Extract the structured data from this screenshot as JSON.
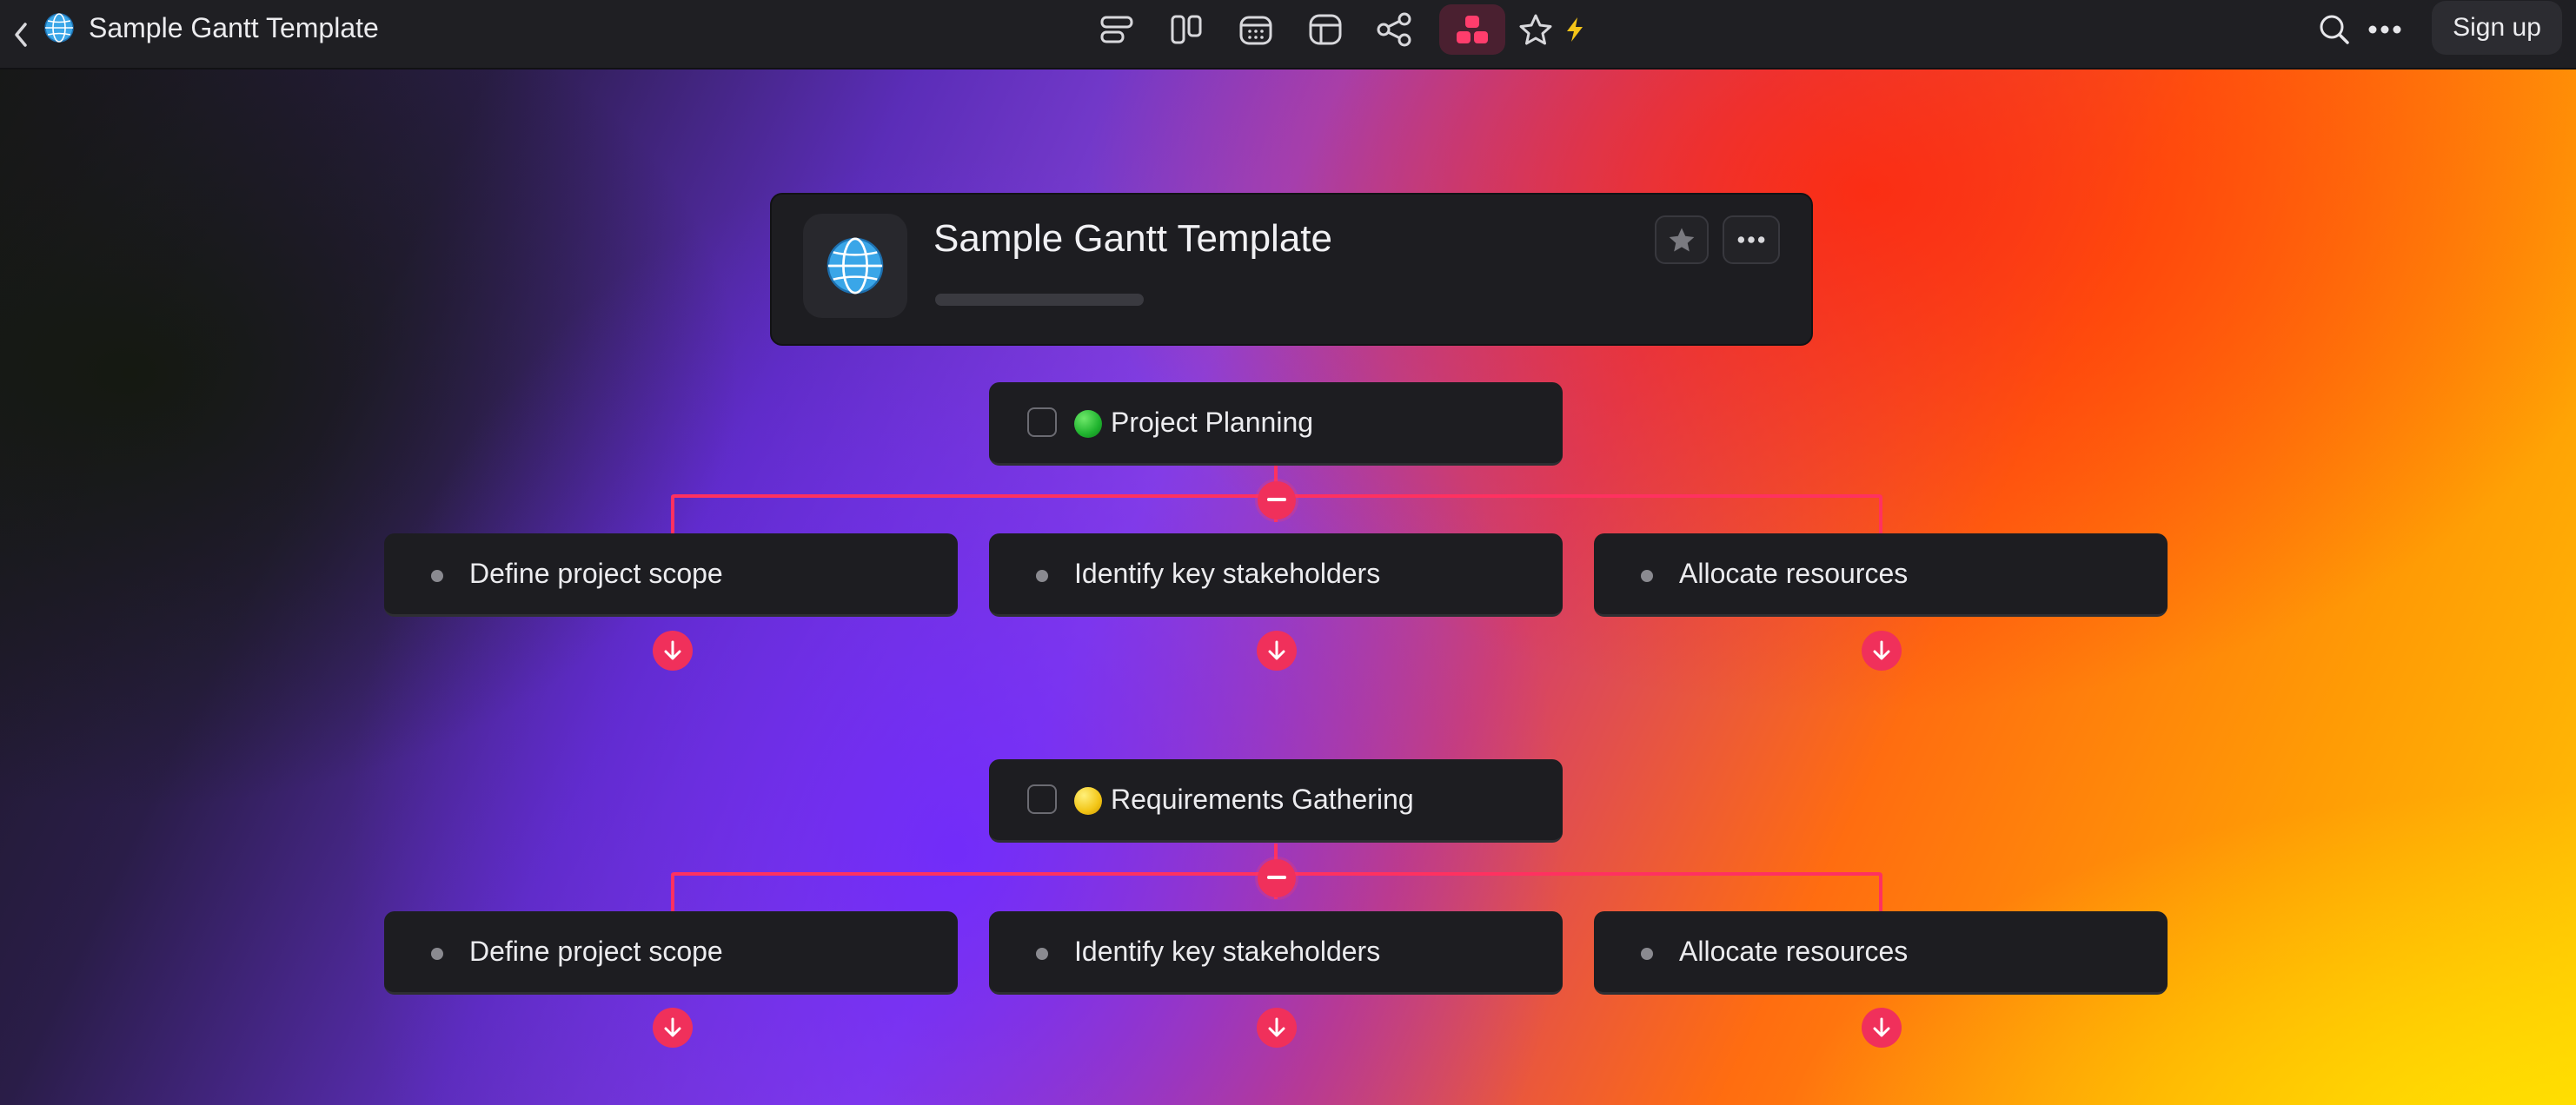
{
  "app": {
    "title": "Sample Gantt Template",
    "icon": "globe-icon"
  },
  "toolbar": {
    "views": [
      {
        "name": "list-view-icon"
      },
      {
        "name": "board-view-icon"
      },
      {
        "name": "calendar-view-icon"
      },
      {
        "name": "table-view-icon"
      },
      {
        "name": "graph-view-icon"
      },
      {
        "name": "mindmap-view-icon",
        "active": true
      },
      {
        "name": "star-icon"
      },
      {
        "name": "bolt-icon"
      }
    ],
    "signup_label": "Sign up"
  },
  "header_card": {
    "title": "Sample Gantt Template",
    "icon": "globe-icon"
  },
  "groups": [
    {
      "title": "Project Planning",
      "status_color": "#1fb32e",
      "children": [
        "Define project scope",
        "Identify key stakeholders",
        "Allocate resources"
      ]
    },
    {
      "title": "Requirements Gathering",
      "status_color": "#f2c516",
      "children": [
        "Define project scope",
        "Identify key stakeholders",
        "Allocate resources"
      ]
    }
  ],
  "colors": {
    "accent": "#f0305b",
    "card_bg": "#1d1d21",
    "topbar_bg": "#1f1f23"
  }
}
